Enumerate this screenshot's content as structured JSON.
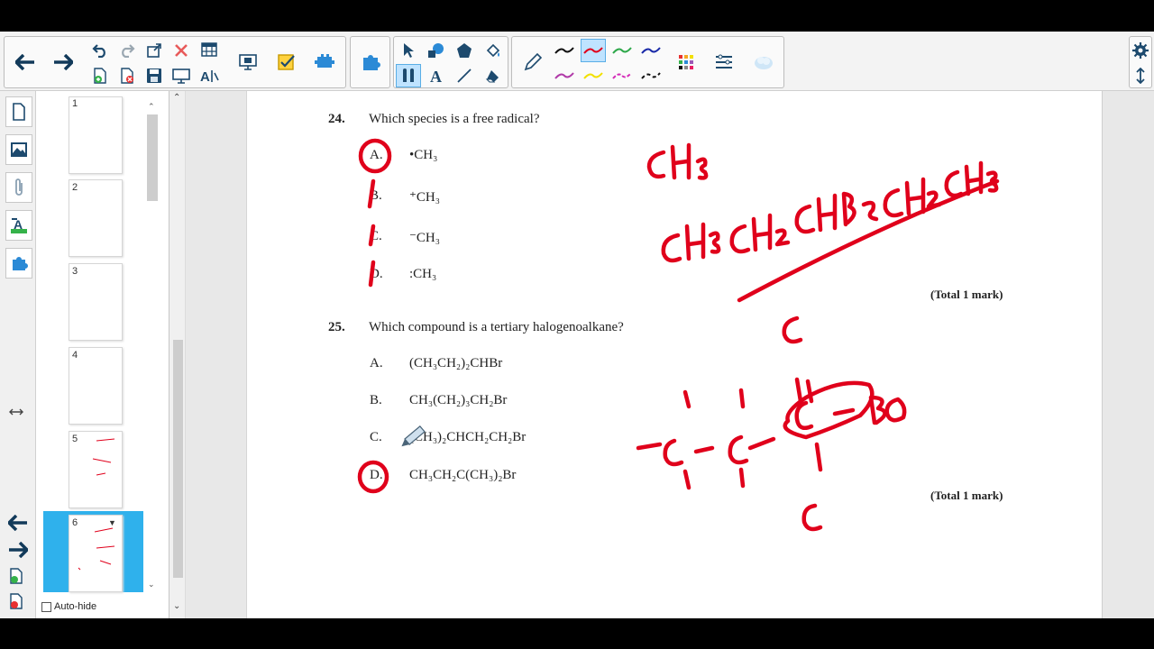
{
  "question24": {
    "number": "24.",
    "text": "Which species is a free radical?",
    "options": [
      {
        "letter": "A.",
        "text": "•CH₃"
      },
      {
        "letter": "B.",
        "text": "⁺CH₃"
      },
      {
        "letter": "C.",
        "text": "⁻CH₃"
      },
      {
        "letter": "D.",
        "text": ":CH₃"
      }
    ],
    "total": "(Total 1 mark)"
  },
  "question25": {
    "number": "25.",
    "text": "Which compound is a tertiary halogenoalkane?",
    "options": [
      {
        "letter": "A.",
        "text": "(CH₃CH₂)₂CHBr"
      },
      {
        "letter": "B.",
        "text": "CH₃(CH₂)₃CH₂Br"
      },
      {
        "letter": "C.",
        "text": "(CH₃)₂CHCH₂CH₂Br"
      },
      {
        "letter": "D.",
        "text": "CH₃CH₂C(CH₃)₂Br"
      }
    ],
    "total": "(Total 1 mark)"
  },
  "sorter": {
    "pages": [
      "1",
      "2",
      "3",
      "4",
      "5",
      "6"
    ],
    "selected_page": "6",
    "autohide_label": "Auto-hide"
  },
  "colors": {
    "ink_red": "#e0001b",
    "selection_blue": "#2fb1ec",
    "active_tool": "#bfe3ff"
  },
  "icons": {
    "toolbar": [
      "back-arrow-icon",
      "forward-arrow-icon",
      "undo-icon",
      "redo-icon",
      "delete-icon",
      "table-icon",
      "add-page-icon",
      "delete-page-icon",
      "save-icon",
      "screen-shade-icon",
      "handwriting-icon",
      "screen-capture-icon",
      "response-icon",
      "add-ons-icon",
      "puzzle-icon",
      "select-icon",
      "shapes-icon",
      "fill-icon",
      "pen-icon",
      "magic-pen-icon",
      "text-icon",
      "line-icon",
      "eraser-icon",
      "color-grid-icon",
      "properties-icon",
      "cloud-icon",
      "gear-icon",
      "move-toolbar-icon"
    ]
  }
}
